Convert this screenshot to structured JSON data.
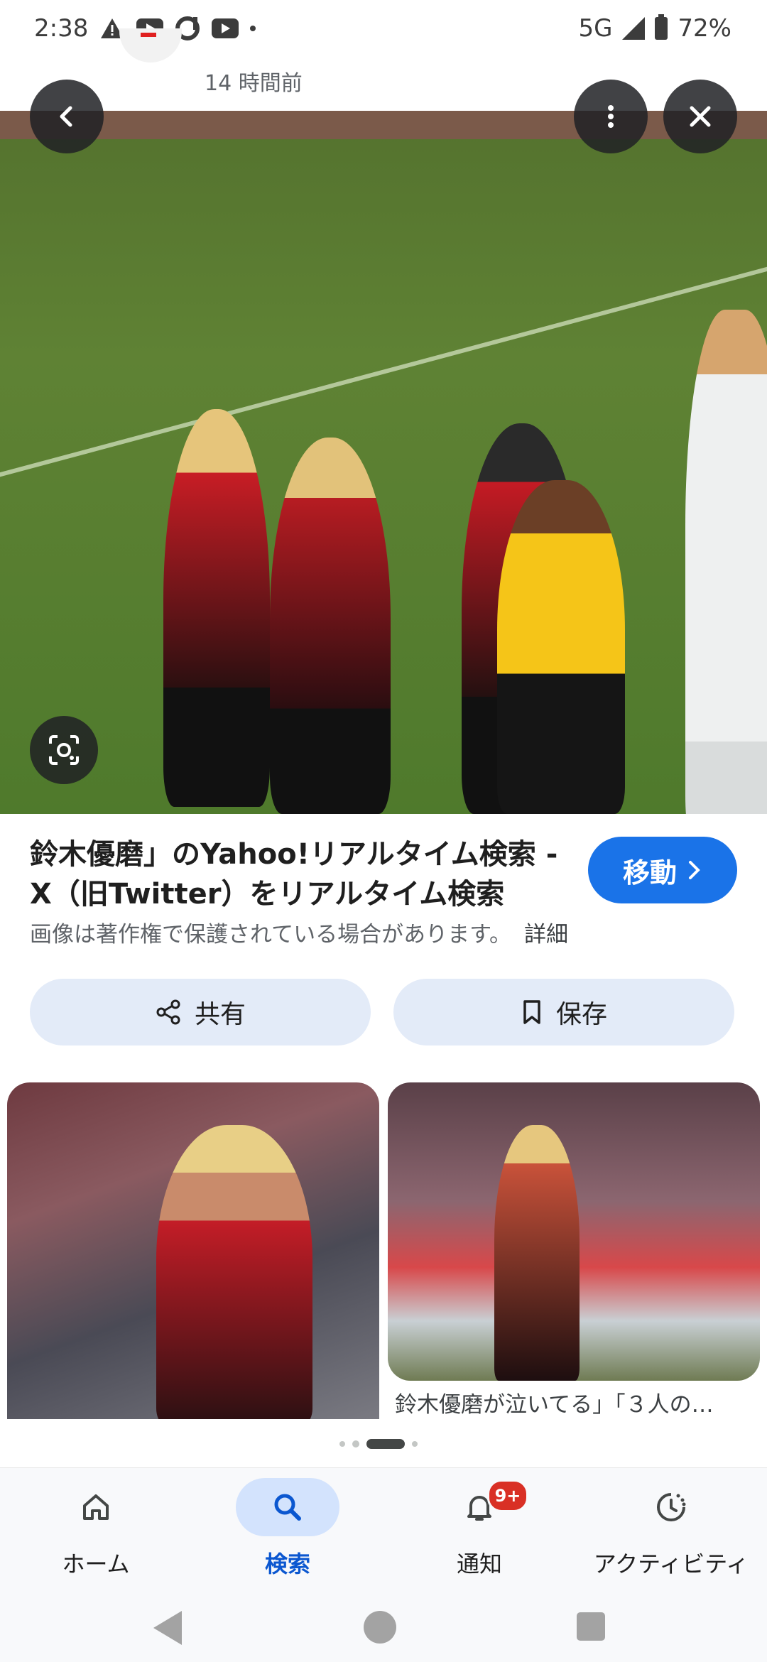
{
  "status_bar": {
    "time": "2:38",
    "network": "5G",
    "battery": "72%"
  },
  "source": {
    "time_ago": "14 時間前"
  },
  "result": {
    "title": "鈴木優磨」のYahoo!リアルタイム検索 - X（旧Twitter）をリアルタイム検索",
    "go_label": "移動",
    "copyright_notice": "画像は著作権で保護されている場合があります。",
    "details_label": "詳細"
  },
  "actions": {
    "share_label": "共有",
    "save_label": "保存"
  },
  "related": [
    {
      "caption": ""
    },
    {
      "caption": "鈴木優磨が泣いてる」「３人の…"
    }
  ],
  "carousel": {
    "page_count": 4,
    "active_index": 2
  },
  "bottom_nav": {
    "items": [
      {
        "label": "ホーム",
        "icon": "home-icon"
      },
      {
        "label": "検索",
        "icon": "search-icon",
        "active": true
      },
      {
        "label": "通知",
        "icon": "bell-icon",
        "badge": "9+"
      },
      {
        "label": "アクティビティ",
        "icon": "activity-icon"
      }
    ]
  },
  "colors": {
    "accent": "#1a73e8",
    "pill_bg": "#e3ebf8",
    "badge": "#d93025"
  }
}
